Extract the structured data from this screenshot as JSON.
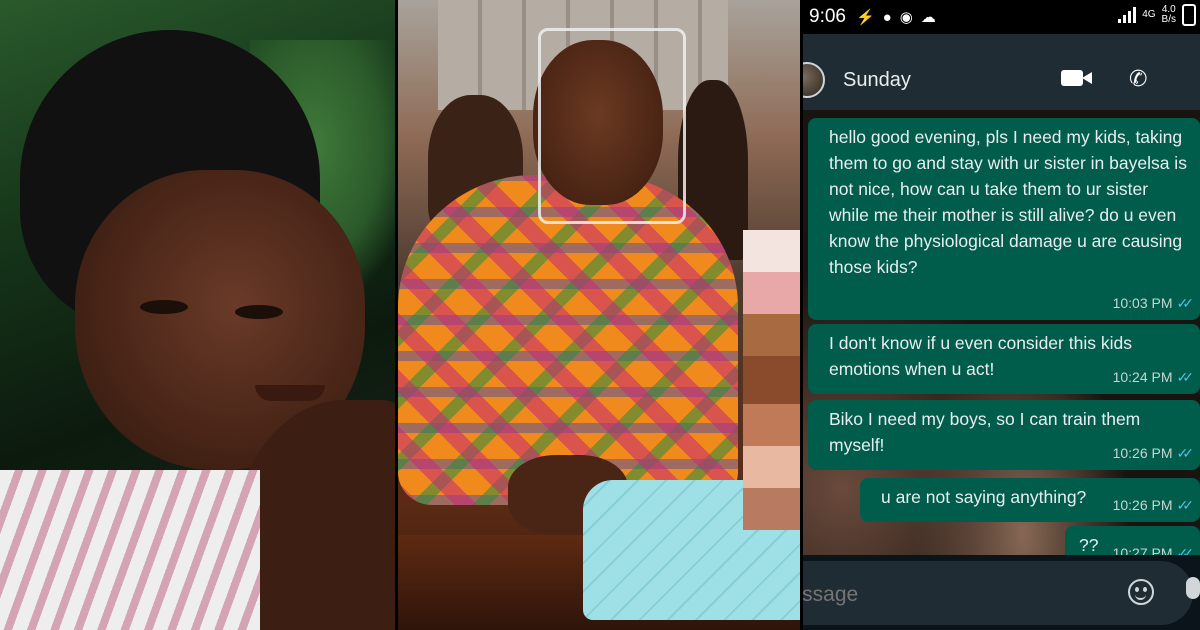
{
  "status_bar": {
    "time": "9:06",
    "network_type": "4G",
    "speed_value": "4.0",
    "speed_unit": "B/s"
  },
  "header": {
    "contact_name": "Sunday"
  },
  "messages": [
    {
      "text": "hello good evening, pls I need my kids, taking them to go and stay with ur sister in bayelsa is not nice, how can u take them to ur sister while me their mother is still alive? do u even know the physiological damage u are causing those kids?",
      "time": "10:03 PM"
    },
    {
      "text": "I don't know if u even consider this kids emotions when u act!",
      "time": "10:24 PM"
    },
    {
      "text": "Biko I need my boys, so I can train them myself!",
      "time": "10:26 PM"
    },
    {
      "text": "u are not saying anything?",
      "time": "10:26 PM"
    },
    {
      "text": "??",
      "time": "10:27 PM"
    }
  ],
  "compose": {
    "placeholder": "Message"
  },
  "icons": {
    "messenger": "messenger-icon",
    "video_call": "video-call-icon",
    "voice_call": "phone-icon",
    "menu": "more-vertical-icon",
    "emoji": "emoji-icon",
    "mic": "mic-icon"
  },
  "colors": {
    "outgoing_bubble": "#005c4b",
    "header_bg": "#1f2c34",
    "read_tick": "#53bdeb"
  }
}
